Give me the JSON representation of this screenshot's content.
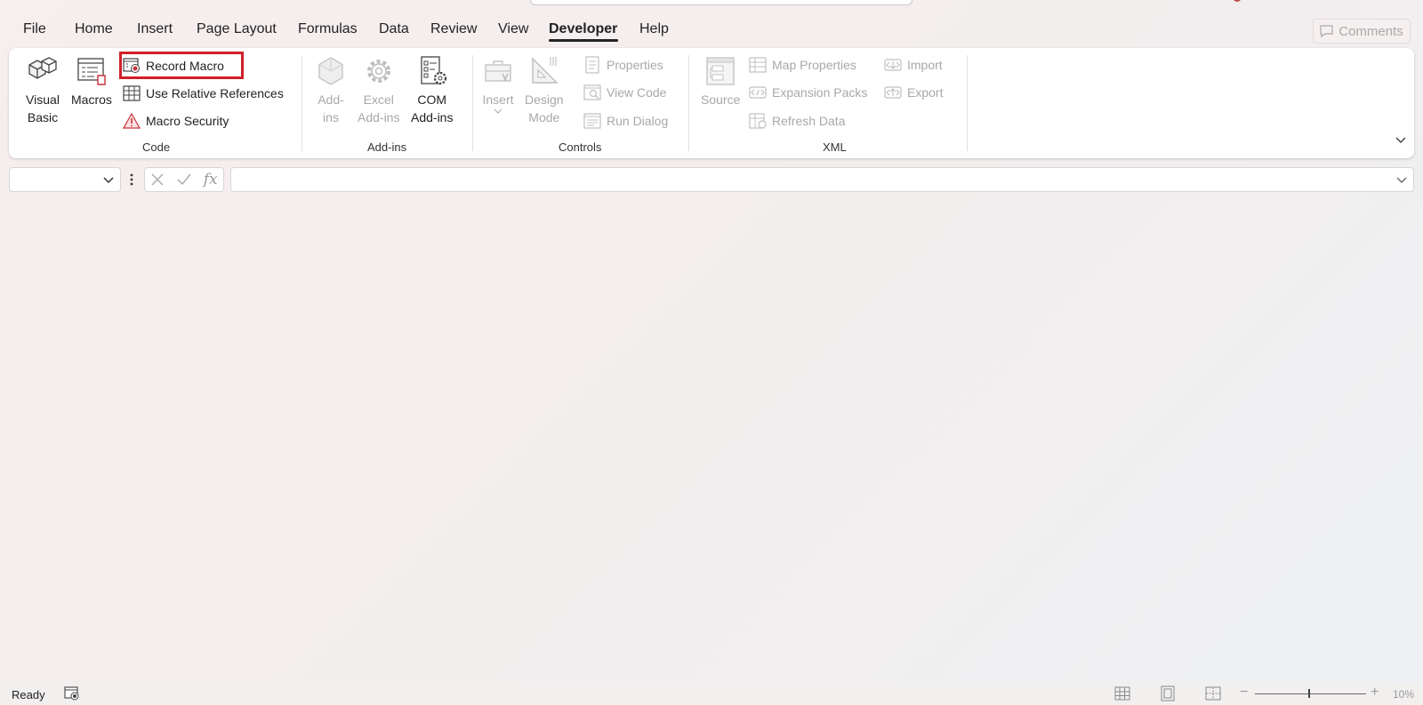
{
  "tabs": [
    {
      "label": "File"
    },
    {
      "label": "Home"
    },
    {
      "label": "Insert"
    },
    {
      "label": "Page Layout"
    },
    {
      "label": "Formulas"
    },
    {
      "label": "Data"
    },
    {
      "label": "Review"
    },
    {
      "label": "View"
    },
    {
      "label": "Developer",
      "active": true
    },
    {
      "label": "Help"
    }
  ],
  "comments_label": "Comments",
  "ribbon": {
    "code": {
      "label": "Code",
      "visual_basic": [
        "Visual",
        "Basic"
      ],
      "macros": "Macros",
      "record_macro": "Record Macro",
      "use_relative_references": "Use Relative References",
      "macro_security": "Macro Security"
    },
    "addins": {
      "label": "Add-ins",
      "addins": [
        "Add-",
        "ins"
      ],
      "excel_addins": [
        "Excel",
        "Add-ins"
      ],
      "com_addins": [
        "COM",
        "Add-ins"
      ]
    },
    "controls": {
      "label": "Controls",
      "insert": "Insert",
      "design_mode": [
        "Design",
        "Mode"
      ],
      "properties": "Properties",
      "view_code": "View Code",
      "run_dialog": "Run Dialog"
    },
    "xml": {
      "label": "XML",
      "source": "Source",
      "map_properties": "Map Properties",
      "expansion_packs": "Expansion Packs",
      "refresh_data": "Refresh Data",
      "import": "Import",
      "export": "Export"
    }
  },
  "formula_bar": {
    "name_box_value": "",
    "formula_value": "",
    "fx_label": "fx"
  },
  "status": {
    "ready": "Ready",
    "zoom": "10%",
    "zoom_fraction": 0.48
  },
  "colors": {
    "highlight": "#d0202a",
    "disabled_text": "#a8a8a8"
  }
}
